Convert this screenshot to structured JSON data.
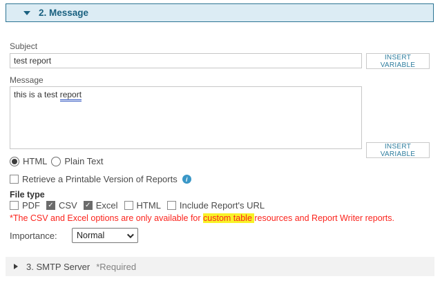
{
  "colors": {
    "header_bg": "#dcecf4",
    "header_border": "#2b7392",
    "header_text": "#19607f",
    "accent_teal": "#2e7d9e",
    "warning_red": "#fb231c",
    "highlight_yellow": "#f8f227",
    "info_blue": "#3a97c7",
    "checked_checkbox_gray": "#6b6b6b",
    "smtp_bar_bg": "#f2f2f2"
  },
  "section_message": {
    "title": "2. Message",
    "subject": {
      "label": "Subject",
      "value": "test report"
    },
    "insert_variable_label": "INSERT VARIABLE",
    "message": {
      "label": "Message",
      "value": "this is a test report",
      "value_before": "this is a test ",
      "spellcheck_word": "report"
    },
    "format_options": [
      {
        "label": "HTML",
        "selected": true
      },
      {
        "label": "Plain Text",
        "selected": false
      }
    ],
    "printable_checkbox": {
      "label": "Retrieve a Printable Version of Reports",
      "checked": false
    },
    "info_icon_glyph": "i",
    "file_type": {
      "label": "File type",
      "options": [
        {
          "label": "PDF",
          "checked": false
        },
        {
          "label": "CSV",
          "checked": true
        },
        {
          "label": "Excel",
          "checked": true
        },
        {
          "label": "HTML",
          "checked": false
        },
        {
          "label": "Include Report's URL",
          "checked": false
        }
      ]
    },
    "warning": {
      "prefix": "*The CSV and Excel options are only available for ",
      "highlighted": "custom table ",
      "suffix": "resources and Report Writer reports."
    },
    "importance": {
      "label": "Importance:",
      "value": "Normal"
    }
  },
  "section_smtp": {
    "title": "3. SMTP Server",
    "required": "*Required"
  }
}
